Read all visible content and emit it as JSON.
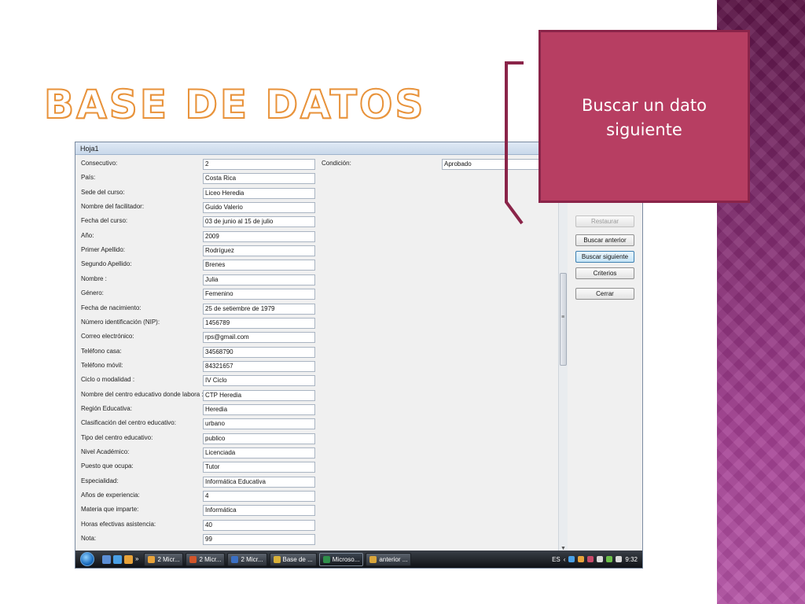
{
  "slide": {
    "title": "BASE DE DATOS",
    "callout_text": "Buscar un dato siguiente",
    "accent_colors": {
      "callout": "#b73e62",
      "title_outline": "#e8923a",
      "side_band": "#7e2a6c"
    }
  },
  "window": {
    "title": "Hoja1",
    "fields": [
      {
        "label": "Consecutivo:",
        "value": "2"
      },
      {
        "label": "País:",
        "value": "Costa Rica"
      },
      {
        "label": "Sede del curso:",
        "value": "Liceo Heredia"
      },
      {
        "label": "Nombre del facilitador:",
        "value": "Guido Valerio"
      },
      {
        "label": "Fecha del curso:",
        "value": "03 de junio al 15 de julio"
      },
      {
        "label": "Año:",
        "value": "2009"
      },
      {
        "label": "Primer Apellido:",
        "value": "Rodríguez"
      },
      {
        "label": "Segundo Apellido:",
        "value": "Brenes"
      },
      {
        "label": "Nombre :",
        "value": "Julia"
      },
      {
        "label": "Género:",
        "value": "Femenino"
      },
      {
        "label": "Fecha de nacimiento:",
        "value": "25 de setiembre de 1979"
      },
      {
        "label": "Número identificación (NIP):",
        "value": "1456789"
      },
      {
        "label": "Correo electrónico:",
        "value": "rps@gmail.com"
      },
      {
        "label": "Teléfono casa:",
        "value": "34568790"
      },
      {
        "label": "Teléfono móvil:",
        "value": "84321657"
      },
      {
        "label": "Ciclo o modalidad :",
        "value": "IV Ciclo"
      },
      {
        "label": "Nombre del centro educativo donde labora :",
        "value": "CTP Heredia"
      },
      {
        "label": "Región Educativa:",
        "value": "Heredia"
      },
      {
        "label": "Clasificación del centro educativo:",
        "value": "urbano"
      },
      {
        "label": "Tipo del centro educativo:",
        "value": "publico"
      },
      {
        "label": "Nivel Académico:",
        "value": "Licenciada"
      },
      {
        "label": "Puesto que ocupa:",
        "value": "Tutor"
      },
      {
        "label": "Especialidad:",
        "value": "Informática Educativa"
      },
      {
        "label": "Años de experiencia:",
        "value": "4"
      },
      {
        "label": "Materia que imparte:",
        "value": "Informática"
      },
      {
        "label": "Horas efectivas asistencia:",
        "value": "40"
      },
      {
        "label": "Nota:",
        "value": "99"
      }
    ],
    "condition": {
      "label": "Condición:",
      "value": "Aprobado"
    },
    "buttons": [
      {
        "label": "Restaurar",
        "state": "disabled"
      },
      {
        "label": "Buscar anterior",
        "state": "normal"
      },
      {
        "label": "Buscar siguiente",
        "state": "active"
      },
      {
        "label": "Criterios",
        "state": "normal"
      },
      {
        "label": "Cerrar",
        "state": "normal"
      }
    ]
  },
  "taskbar": {
    "items": [
      {
        "label": "2 Micr...",
        "icon": "outlook-icon",
        "color": "#e8a33a"
      },
      {
        "label": "2 Micr...",
        "icon": "powerpoint-icon",
        "color": "#d2552a"
      },
      {
        "label": "2 Micr...",
        "icon": "word-icon",
        "color": "#3a6fc4"
      },
      {
        "label": "Base de ...",
        "icon": "folder-icon",
        "color": "#d9b13a"
      },
      {
        "label": "Microso...",
        "icon": "excel-icon",
        "color": "#2f8f4a",
        "active": true
      },
      {
        "label": "anterior ...",
        "icon": "paint-icon",
        "color": "#d9a53a"
      }
    ],
    "overflow_glyph": "»",
    "language": "ES",
    "clock": "9:32"
  }
}
